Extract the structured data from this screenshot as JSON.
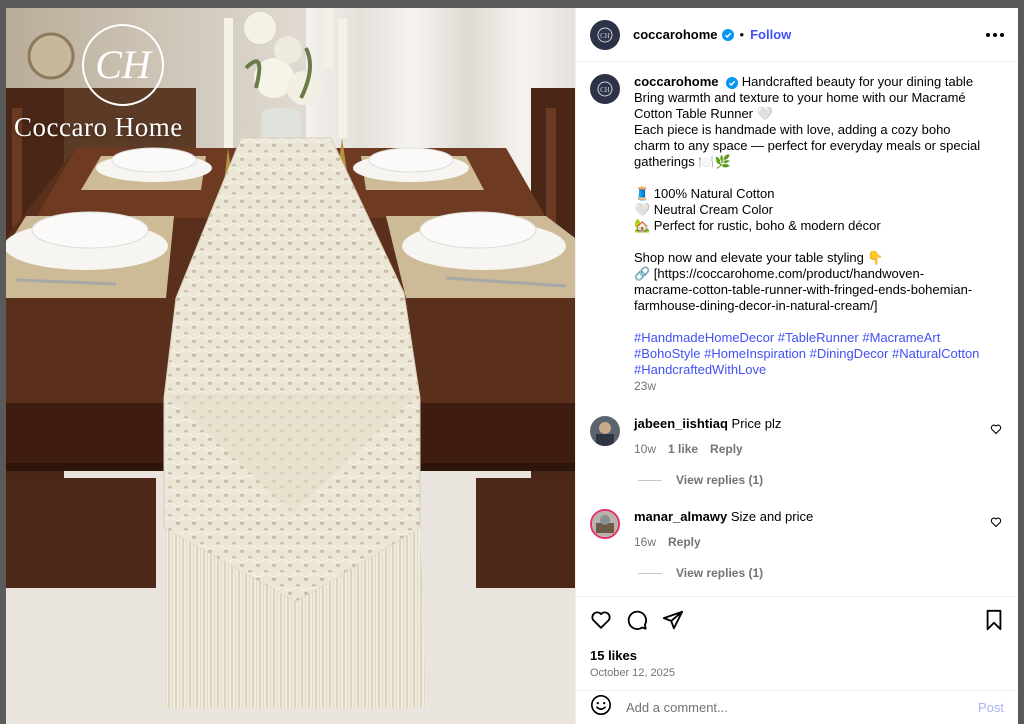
{
  "photo": {
    "watermark": "Coccaro Home",
    "logo_monogram": "CH"
  },
  "header": {
    "username": "coccarohome",
    "dot": "•",
    "follow_label": "Follow",
    "more_icon": "more-horizontal-icon"
  },
  "caption": {
    "username": "coccarohome",
    "line1": "Handcrafted beauty for your dining table",
    "line2": "Bring warmth and texture to your home with our Macramé Cotton Table Runner 🤍",
    "line3": "Each piece is handmade with love, adding a cozy boho charm to any space — perfect for everyday meals or special gatherings 🍽️🌿",
    "bullet1": "🧵 100% Natural Cotton",
    "bullet2": "🤍 Neutral Cream Color",
    "bullet3": "🏡 Perfect for rustic, boho & modern décor",
    "shop": "Shop now and elevate your table styling 👇",
    "link": "🔗 [https://coccarohome.com/product/handwoven-macrame-cotton-table-runner-with-fringed-ends-bohemian-farmhouse-dining-decor-in-natural-cream/]",
    "hashtags": "#HandmadeHomeDecor #TableRunner #MacrameArt #BohoStyle #HomeInspiration #DiningDecor #NaturalCotton #HandcraftedWithLove",
    "time": "23w"
  },
  "comments": [
    {
      "username": "jabeen_iishtiaq",
      "text": "Price plz",
      "time": "10w",
      "likes": "1 like",
      "reply": "Reply",
      "view_replies": "View replies (1)"
    },
    {
      "username": "manar_almawy",
      "text": "Size and price",
      "time": "16w",
      "reply": "Reply",
      "view_replies": "View replies (1)"
    }
  ],
  "footer": {
    "likes": "15 likes",
    "date": "October 12, 2025",
    "comment_placeholder": "Add a comment...",
    "post_label": "Post"
  },
  "colors": {
    "accent": "#4150f7",
    "muted": "#737373",
    "post_disabled": "#a6b6f5"
  }
}
